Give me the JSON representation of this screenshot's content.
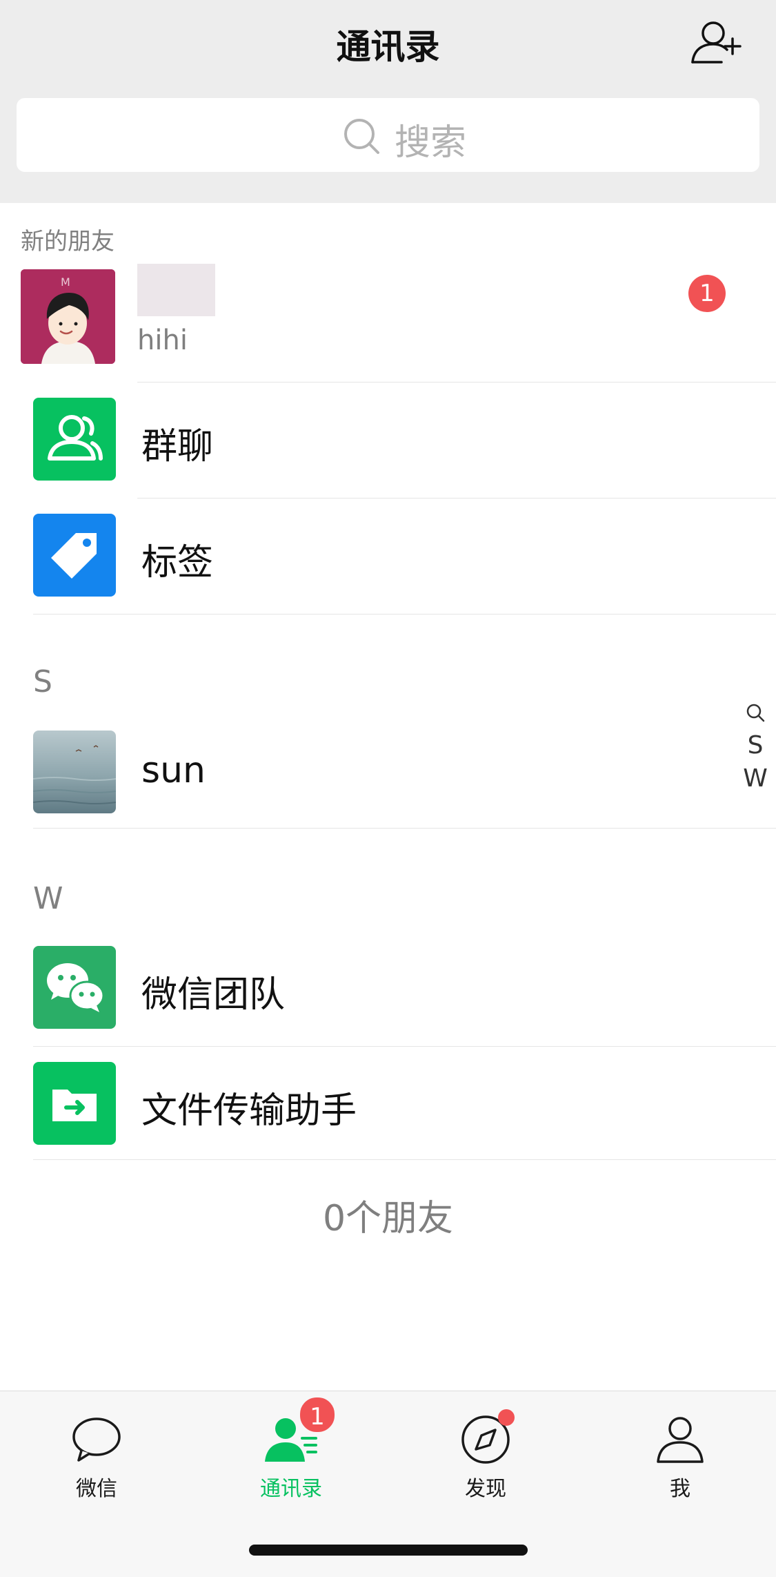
{
  "header": {
    "title": "通讯录",
    "add_icon": "add-friend-icon"
  },
  "search": {
    "placeholder": "搜索",
    "icon": "search-icon"
  },
  "new_friends": {
    "caption": "新的朋友",
    "message": "hihi",
    "badge_count": "1"
  },
  "entries": {
    "group_chats": "群聊",
    "tags": "标签"
  },
  "contacts": {
    "section_s": "S",
    "sun": "sun",
    "section_w": "W",
    "wechat_team": "微信团队",
    "file_transfer": "文件传输助手"
  },
  "side_index": [
    "Q-search",
    "S",
    "W"
  ],
  "side_index_letters": {
    "s": "S",
    "w": "W"
  },
  "friend_count": "0个朋友",
  "tabbar": {
    "chats": "微信",
    "contacts": "通讯录",
    "discover": "发现",
    "me": "我",
    "contacts_badge": "1"
  },
  "colors": {
    "accent": "#07c160",
    "badge": "#f15254",
    "tag_blue": "#1485ee",
    "wechat_team_green": "#2aae67"
  }
}
